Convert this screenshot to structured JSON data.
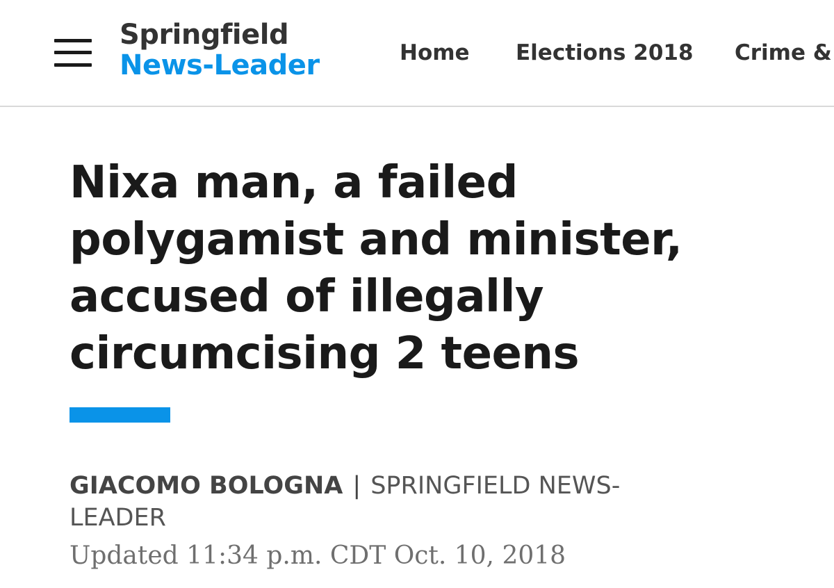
{
  "header": {
    "menu_icon": "hamburger-menu-icon",
    "brand_line1": "Springfield",
    "brand_line2": "News-Leader",
    "nav": {
      "home": "Home",
      "elections": "Elections 2018",
      "crime": "Crime & Courts"
    }
  },
  "article": {
    "headline": "Nixa man, a failed polygamist and minister, accused of illegally circumcising 2 teens",
    "author": "GIACOMO BOLOGNA",
    "separator": "|",
    "organization": "SPRINGFIELD NEWS-LEADER",
    "updated": "Updated 11:34 p.m. CDT Oct. 10, 2018"
  },
  "colors": {
    "brand_blue": "#0a93e8",
    "text_dark": "#1a1a1a",
    "text_gray": "#555555"
  }
}
